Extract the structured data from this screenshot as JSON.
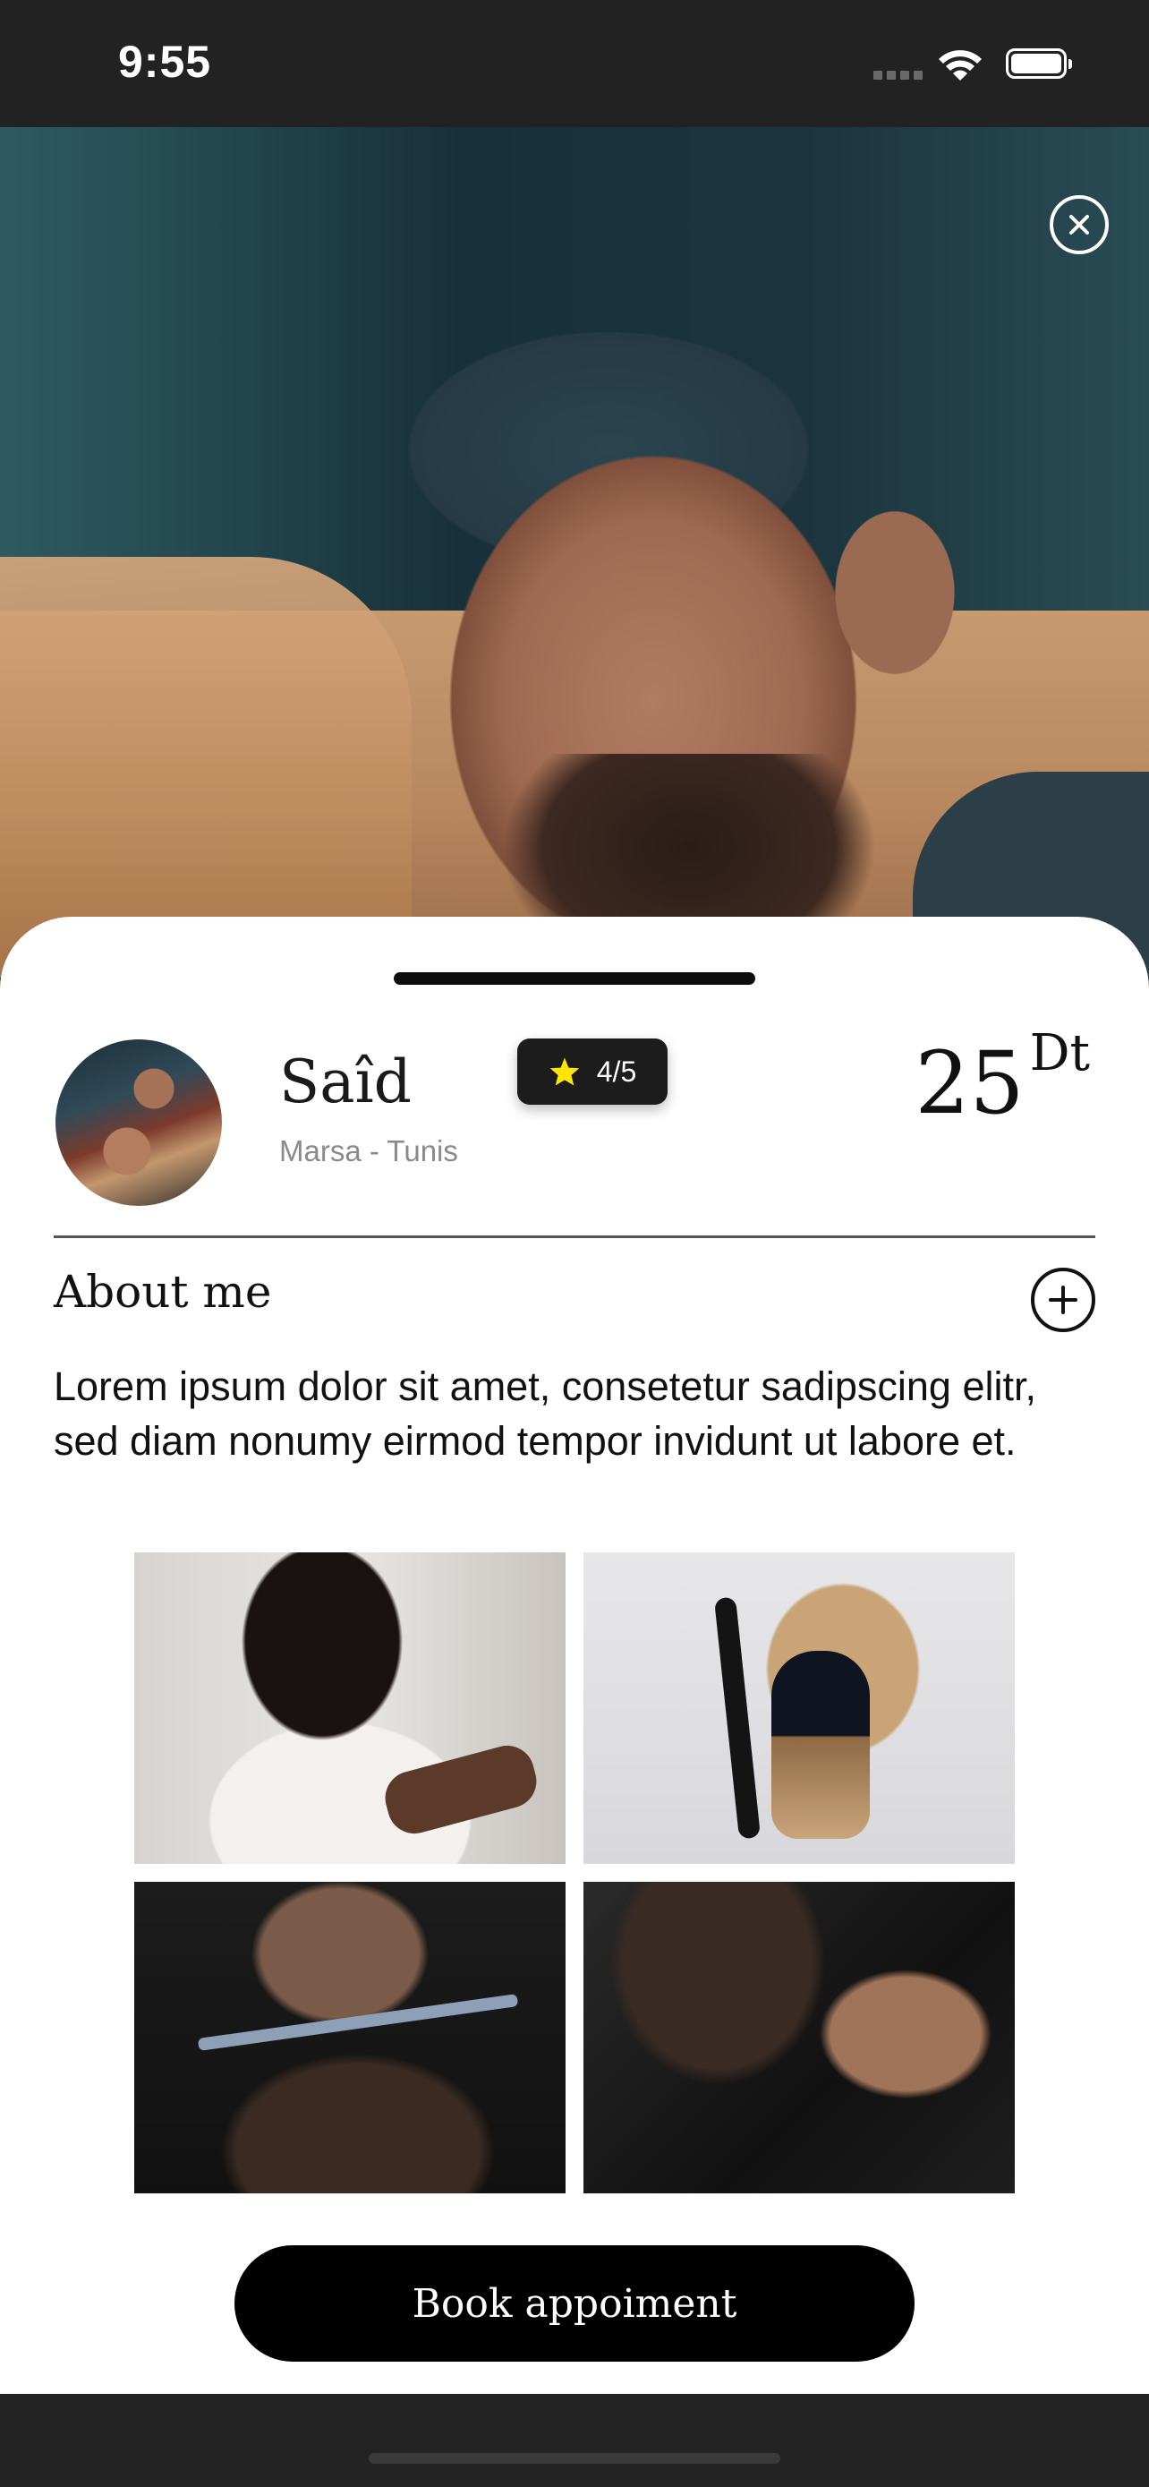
{
  "status_bar": {
    "time": "9:55",
    "icons": [
      "signal-icon",
      "wifi-icon",
      "battery-icon"
    ]
  },
  "hero": {
    "close_icon": "close-icon"
  },
  "profile": {
    "name": "Saîd",
    "location": "Marsa - Tunis",
    "rating": "4/5",
    "rating_icon": "star-icon",
    "star_color": "#FFE600",
    "price": "25",
    "currency": "Dt"
  },
  "about": {
    "title": "About me",
    "expand_icon": "plus-circle-icon",
    "text": "Lorem ipsum dolor sit amet, consetetur sadipscing elitr, sed diam nonumy eirmod tempor invidunt ut labore et."
  },
  "gallery": {
    "images": [
      "barber-clipper-photo",
      "razor-and-brush-photo",
      "scissors-haircut-photo",
      "barber-styling-photo"
    ]
  },
  "actions": {
    "book_label": "Book appoiment"
  },
  "colors": {
    "sheet_background": "#FFFFFF",
    "button_background": "#000000",
    "status_bar_background": "#222222"
  }
}
